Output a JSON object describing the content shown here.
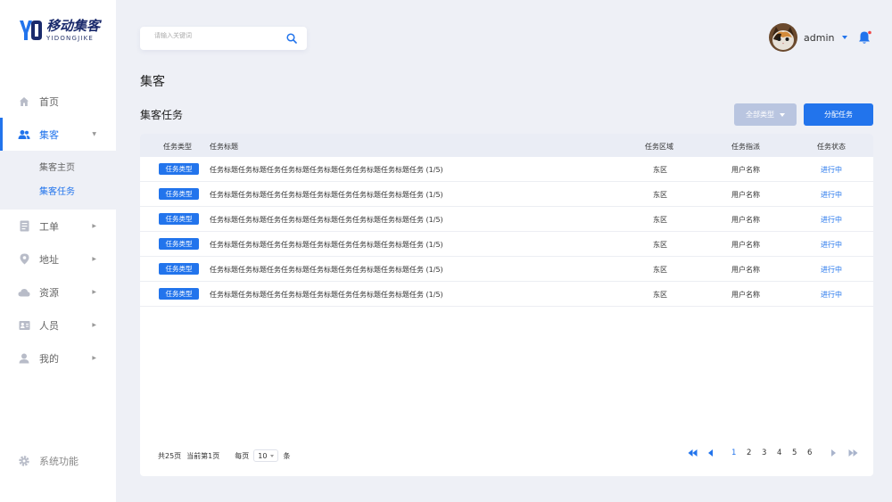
{
  "brand": {
    "name_cn": "移动集客",
    "name_en": "YIDONGJIKE",
    "accent": "#2274ec"
  },
  "sidebar": {
    "items": [
      {
        "label": "首页",
        "icon": "home-icon"
      },
      {
        "label": "集客",
        "icon": "users-icon",
        "active": true
      },
      {
        "label": "工单",
        "icon": "document-icon"
      },
      {
        "label": "地址",
        "icon": "location-pin-icon"
      },
      {
        "label": "资源",
        "icon": "cloud-icon"
      },
      {
        "label": "人员",
        "icon": "people-card-icon"
      },
      {
        "label": "我的",
        "icon": "user-icon"
      }
    ],
    "subitems": [
      {
        "label": "集客主页"
      },
      {
        "label": "集客任务",
        "active": true
      }
    ],
    "bottom": {
      "label": "系统功能",
      "icon": "gear-icon"
    }
  },
  "header": {
    "search_placeholder": "请输入关键词",
    "user_name": "admin"
  },
  "main": {
    "page_title": "集客",
    "section_title": "集客任务",
    "filter_label": "全部类型",
    "assign_label": "分配任务"
  },
  "table": {
    "columns": [
      "任务类型",
      "任务标题",
      "任务区域",
      "任务指派",
      "任务状态"
    ],
    "rows": [
      {
        "type": "任务类型",
        "title": "任务标题任务标题任务任务标题任务标题任务任务标题任务标题任务 (1/5)",
        "area": "东区",
        "assignee": "用户名称",
        "status": "进行中"
      },
      {
        "type": "任务类型",
        "title": "任务标题任务标题任务任务标题任务标题任务任务标题任务标题任务 (1/5)",
        "area": "东区",
        "assignee": "用户名称",
        "status": "进行中"
      },
      {
        "type": "任务类型",
        "title": "任务标题任务标题任务任务标题任务标题任务任务标题任务标题任务 (1/5)",
        "area": "东区",
        "assignee": "用户名称",
        "status": "进行中"
      },
      {
        "type": "任务类型",
        "title": "任务标题任务标题任务任务标题任务标题任务任务标题任务标题任务 (1/5)",
        "area": "东区",
        "assignee": "用户名称",
        "status": "进行中"
      },
      {
        "type": "任务类型",
        "title": "任务标题任务标题任务任务标题任务标题任务任务标题任务标题任务 (1/5)",
        "area": "东区",
        "assignee": "用户名称",
        "status": "进行中"
      },
      {
        "type": "任务类型",
        "title": "任务标题任务标题任务任务标题任务标题任务任务标题任务标题任务 (1/5)",
        "area": "东区",
        "assignee": "用户名称",
        "status": "进行中"
      }
    ]
  },
  "pagination": {
    "total": "共25页",
    "current": "当前第1页",
    "per_page_label": "每页",
    "page_size": "10",
    "unit": "条",
    "pages": [
      "1",
      "2",
      "3",
      "4",
      "5",
      "6"
    ],
    "current_page": "1"
  }
}
